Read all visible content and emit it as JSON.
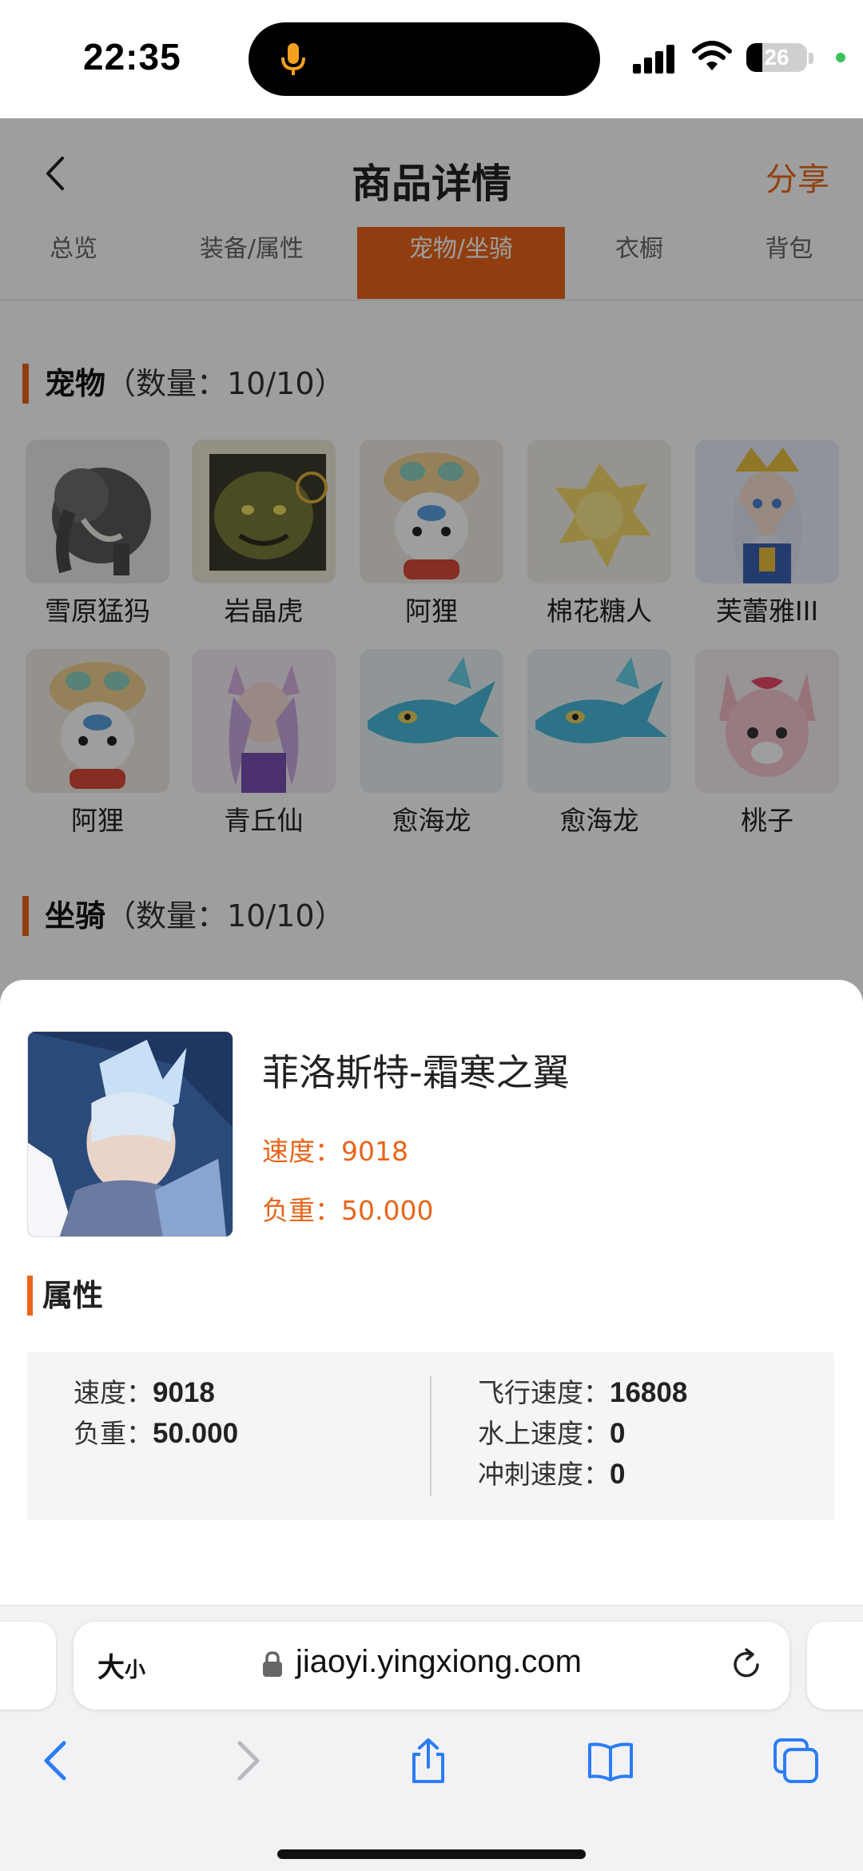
{
  "status_bar": {
    "time": "22:35",
    "battery": "26",
    "battery_level": 0.26
  },
  "header": {
    "title": "商品详情",
    "share_label": "分享"
  },
  "tabs": [
    {
      "label": "总览",
      "active": false
    },
    {
      "label": "装备/属性",
      "active": false
    },
    {
      "label": "宠物/坐骑",
      "active": true
    },
    {
      "label": "衣橱",
      "active": false
    },
    {
      "label": "背包",
      "active": false
    }
  ],
  "pets_section": {
    "title": "宠物",
    "count_text": "（数量：10/10）"
  },
  "pets": [
    {
      "name": "雪原猛犸",
      "icon": "mammoth"
    },
    {
      "name": "岩晶虎",
      "icon": "tiger"
    },
    {
      "name": "阿狸",
      "icon": "ali"
    },
    {
      "name": "棉花糖人",
      "icon": "cotton"
    },
    {
      "name": "芙蕾雅III",
      "icon": "freya"
    },
    {
      "name": "阿狸",
      "icon": "ali"
    },
    {
      "name": "青丘仙",
      "icon": "fox-fairy"
    },
    {
      "name": "愈海龙",
      "icon": "sea-dragon"
    },
    {
      "name": "愈海龙",
      "icon": "sea-dragon"
    },
    {
      "name": "桃子",
      "icon": "peach"
    }
  ],
  "mounts_section": {
    "title": "坐骑",
    "count_text": "（数量：10/10）"
  },
  "detail": {
    "name": "菲洛斯特-霜寒之翼",
    "speed_text": "速度：9018",
    "load_text": "负重：50.000",
    "attributes_title": "属性",
    "left_attributes": [
      {
        "label": "速度：",
        "value": "9018"
      },
      {
        "label": "负重：",
        "value": "50.000"
      }
    ],
    "right_attributes": [
      {
        "label": "飞行速度：",
        "value": "16808"
      },
      {
        "label": "水上速度：",
        "value": "0"
      },
      {
        "label": "冲刺速度：",
        "value": "0"
      }
    ]
  },
  "browser": {
    "text_size_large": "大",
    "text_size_small": "小",
    "url": "jiaoyi.yingxiong.com"
  },
  "colors": {
    "accent": "#e8651a",
    "overlay": "rgba(0,0,0,0.38)"
  }
}
